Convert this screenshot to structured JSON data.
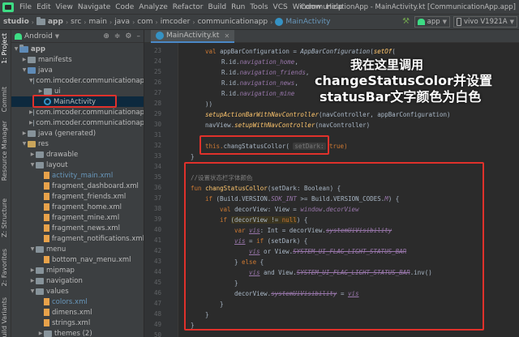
{
  "menubar": {
    "items": [
      "File",
      "Edit",
      "View",
      "Navigate",
      "Code",
      "Analyze",
      "Refactor",
      "Build",
      "Run",
      "Tools",
      "VCS",
      "Window",
      "Help"
    ],
    "window_title": "CommunicationApp - MainActivity.kt [CommunicationApp.app]"
  },
  "breadcrumb": [
    "studio",
    "app",
    "src",
    "main",
    "java",
    "com",
    "imcoder",
    "communicationapp",
    "MainActivity"
  ],
  "toolbar": {
    "run_config": "app",
    "device": "vivo V1921A"
  },
  "toolstrip": {
    "labels": [
      "1: Project",
      "Commit",
      "Resource Manager",
      "Z: Structure",
      "2: Favorites",
      "Build Variants"
    ]
  },
  "project_panel": {
    "view_label": "Android",
    "tree": [
      {
        "label": "app",
        "kind": "module"
      },
      {
        "label": "manifests",
        "kind": "folder"
      },
      {
        "label": "java",
        "kind": "folder"
      },
      {
        "label": "com.imcoder.communicationap",
        "kind": "package"
      },
      {
        "label": "ui",
        "kind": "package"
      },
      {
        "label": "MainActivity",
        "kind": "kotlin",
        "selected": true
      },
      {
        "label": "com.imcoder.communicationap",
        "kind": "package"
      },
      {
        "label": "com.imcoder.communicationap",
        "kind": "package"
      },
      {
        "label": "java (generated)",
        "kind": "folder"
      },
      {
        "label": "res",
        "kind": "folder"
      },
      {
        "label": "drawable",
        "kind": "folder"
      },
      {
        "label": "layout",
        "kind": "folder"
      },
      {
        "label": "activity_main.xml",
        "kind": "xml-blue"
      },
      {
        "label": "fragment_dashboard.xml",
        "kind": "xml"
      },
      {
        "label": "fragment_friends.xml",
        "kind": "xml"
      },
      {
        "label": "fragment_home.xml",
        "kind": "xml"
      },
      {
        "label": "fragment_mine.xml",
        "kind": "xml"
      },
      {
        "label": "fragment_news.xml",
        "kind": "xml"
      },
      {
        "label": "fragment_notifications.xml",
        "kind": "xml"
      },
      {
        "label": "menu",
        "kind": "folder"
      },
      {
        "label": "bottom_nav_menu.xml",
        "kind": "xml"
      },
      {
        "label": "mipmap",
        "kind": "folder"
      },
      {
        "label": "navigation",
        "kind": "folder"
      },
      {
        "label": "values",
        "kind": "folder"
      },
      {
        "label": "colors.xml",
        "kind": "xml-blue"
      },
      {
        "label": "dimens.xml",
        "kind": "xml"
      },
      {
        "label": "strings.xml",
        "kind": "xml"
      },
      {
        "label": "themes (2)",
        "kind": "folder"
      }
    ]
  },
  "editor": {
    "tab_label": "MainActivity.kt",
    "line_numbers": [
      23,
      24,
      25,
      26,
      27,
      28,
      29,
      30,
      31,
      32,
      33,
      34,
      35,
      36,
      37,
      38,
      39,
      40,
      41,
      42,
      43,
      44,
      45,
      46,
      47,
      48,
      49,
      50
    ],
    "lines": {
      "l23_a": "val ",
      "l23_b": "appBarConfiguration = ",
      "l23_c": "AppBarConfiguration",
      "l23_d": "(",
      "l23_e": "setOf",
      "l23_f": "(",
      "l24": "R.id.",
      "l24_p": "navigation_home",
      "l25_p": "navigation_friends",
      "l26_p": "navigation_news",
      "l27_p": "navigation_mine",
      "l28": "))",
      "l29_a": "setupActionBarWithNavController",
      "l29_b": "(navController, appBarConfiguration)",
      "l30_a": "navView.",
      "l30_b": "setupWithNavController",
      "l30_c": "(navController)",
      "l32_a": "this.",
      "l32_b": "changStatusCollor",
      "l32_c": "( ",
      "l32_hint": "setDark:",
      "l32_d": " true)",
      "l33": "}",
      "l35": "//设置状态栏字体颜色",
      "l36_a": "fun ",
      "l36_b": "changStatusCollor",
      "l36_c": "(setDark: Boolean) {",
      "l37_a": "if ",
      "l37_b": "(Build.VERSION.",
      "l37_c": "SDK_INT",
      "l37_d": " >= Build.VERSION_CODES.",
      "l37_e": "M",
      "l37_f": ") {",
      "l38_a": "val ",
      "l38_b": "decorView: View = ",
      "l38_c": "window",
      "l38_d": ".",
      "l38_e": "decorView",
      "l39_a": "if ",
      "l39_b": "(decorView != ",
      "l39_c": "null",
      "l39_d": ") {",
      "l40_a": "var ",
      "l40_b": "vis",
      "l40_c": ": Int = decorView.",
      "l40_d": "systemUiVisibility",
      "l41_a": "vis",
      "l41_b": " = ",
      "l41_c": "if ",
      "l41_d": "(setDark) {",
      "l42_a": "vis",
      "l42_b": " or View.",
      "l42_c": "SYSTEM_UI_FLAG_LIGHT_STATUS_BAR",
      "l43_a": "} ",
      "l43_b": "else ",
      "l43_c": "{",
      "l44_a": "vis",
      "l44_b": " and View.",
      "l44_c": "SYSTEM_UI_FLAG_LIGHT_STATUS_BAR",
      "l44_d": ".inv()",
      "l45": "}",
      "l46_a": "decorView.",
      "l46_b": "systemUiVisibility",
      "l46_c": " = ",
      "l46_d": "vis",
      "l47": "}",
      "l48": "}",
      "l49": "}"
    }
  },
  "annotation": {
    "line1": "我在这里调用",
    "line2": "changeStatusColor并设置",
    "line3": "statusBar文字颜色为白色"
  },
  "colors": {
    "highlight_box": "#e0312b",
    "annotation_text": "#ffffff"
  }
}
